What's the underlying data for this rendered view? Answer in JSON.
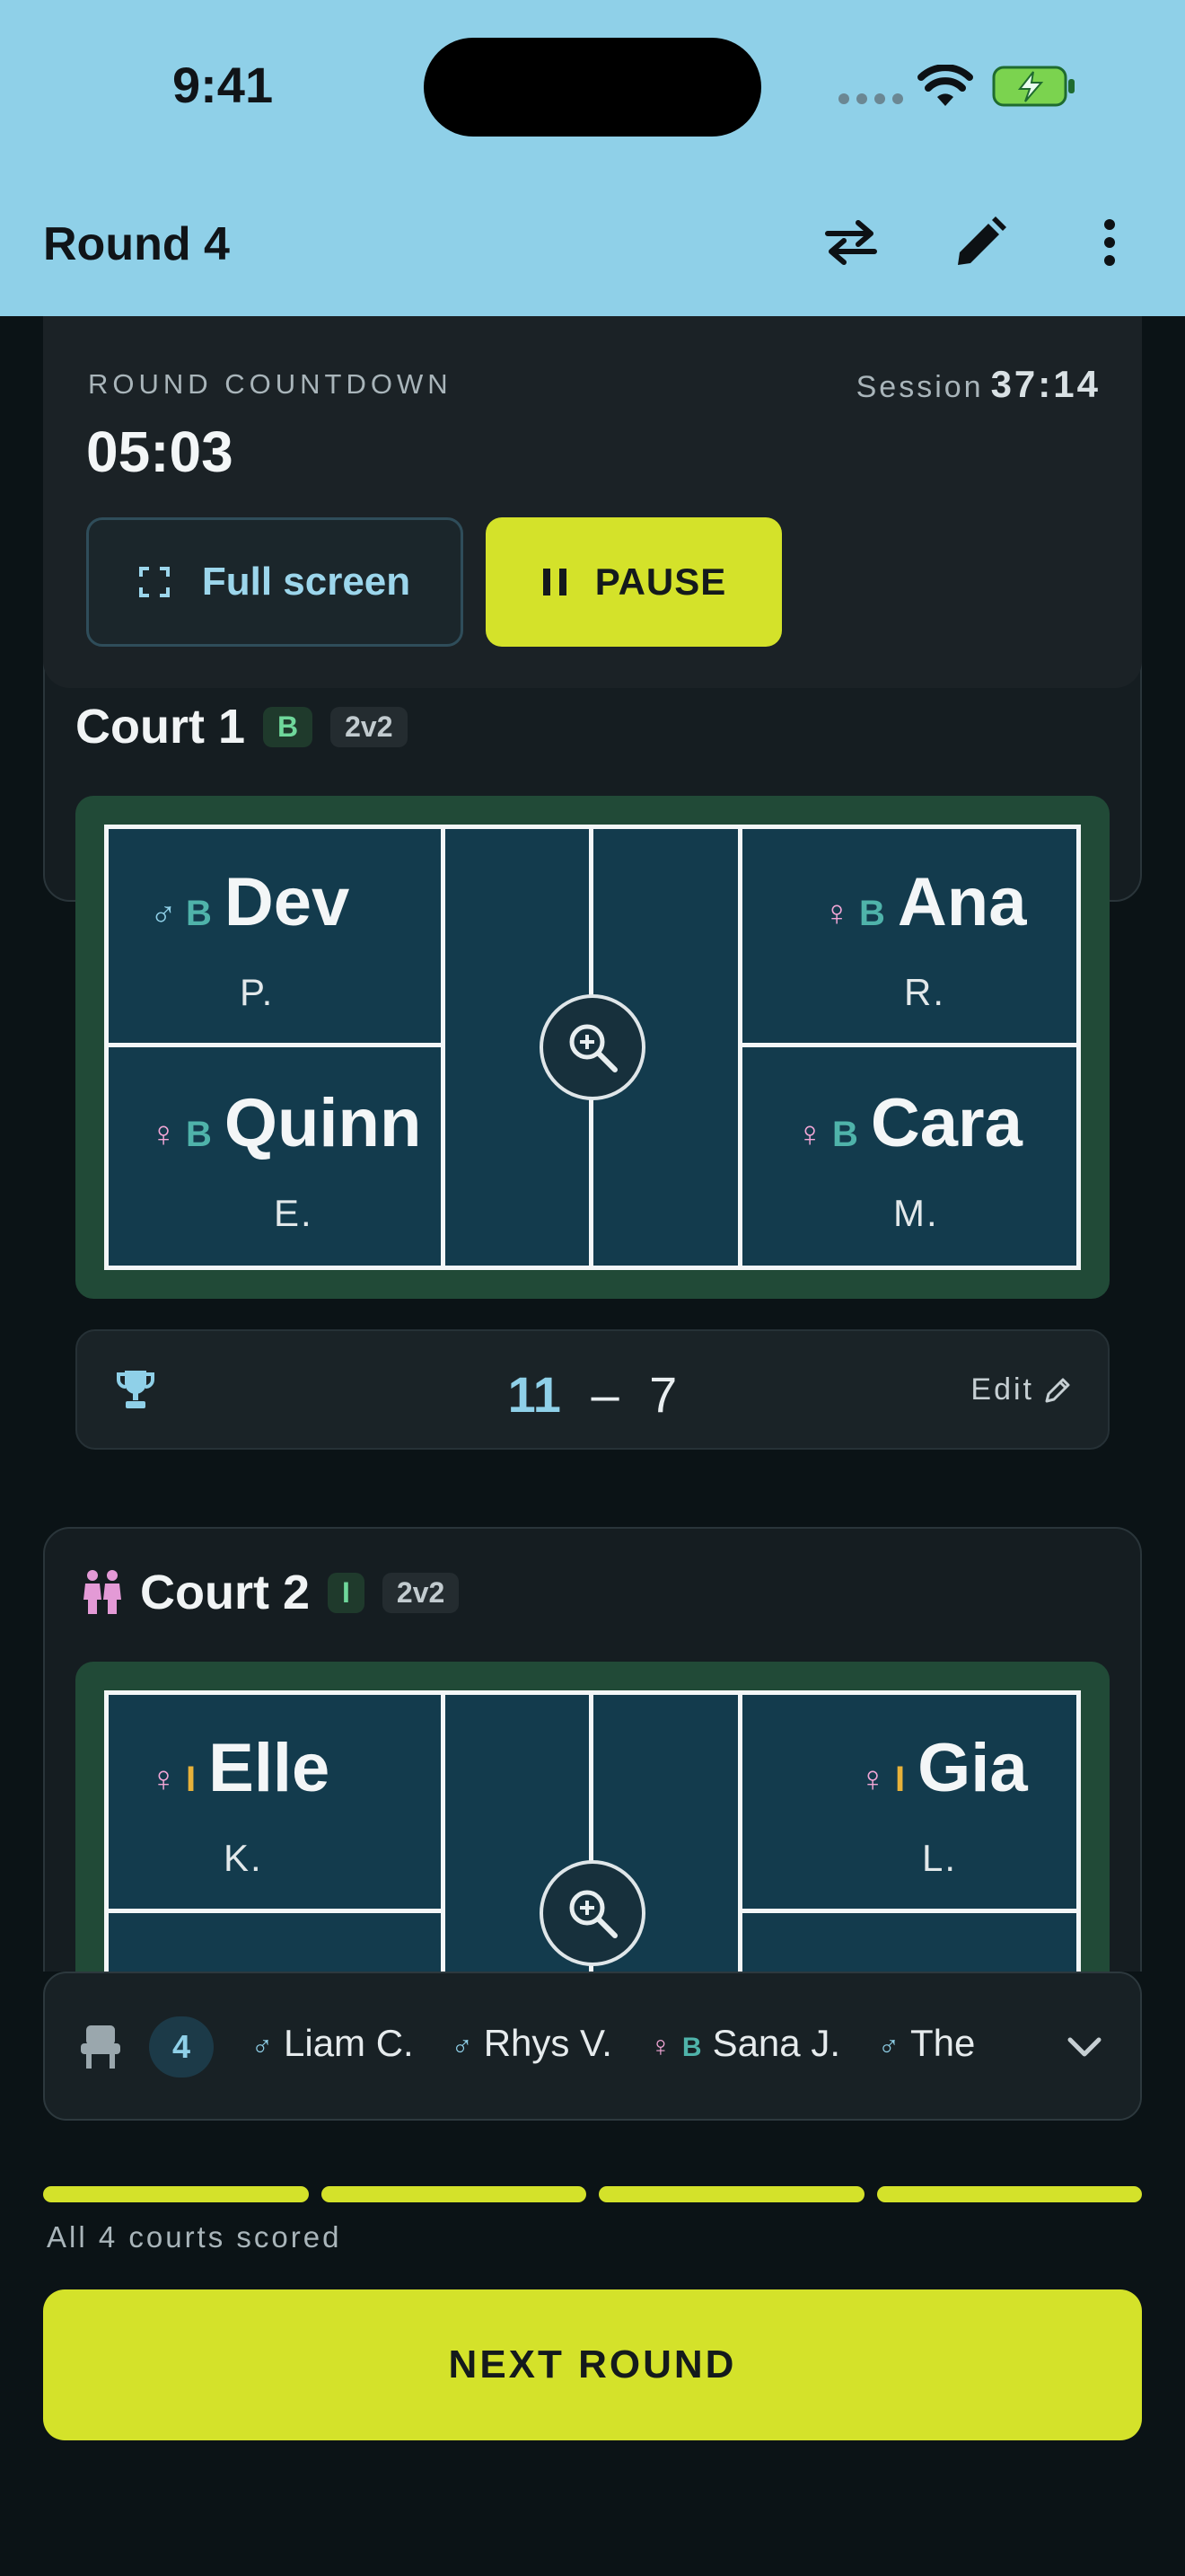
{
  "status_bar": {
    "time": "9:41"
  },
  "app_bar": {
    "title": "Round 4"
  },
  "colors": {
    "accent": "#d4e22a",
    "header": "#8fd0e8",
    "male": "#8fd0e8",
    "female": "#f2a6d6",
    "level_b": "#4fb3aa",
    "level_i": "#e8b23a",
    "court_surface": "#133b4d",
    "court_surround": "#214a37"
  },
  "countdown": {
    "label": "ROUND COUNTDOWN",
    "time": "05:03",
    "session_label": "Session",
    "session_time": "37:14",
    "full_screen_label": "Full screen",
    "pause_label": "PAUSE"
  },
  "courts": [
    {
      "name": "Court 1",
      "level": "B",
      "format": "2v2",
      "players": [
        {
          "gender": "♂",
          "level": "B",
          "first": "Dev",
          "last": "P."
        },
        {
          "gender": "♀",
          "level": "B",
          "first": "Quinn",
          "last": "E."
        },
        {
          "gender": "♀",
          "level": "B",
          "first": "Ana",
          "last": "R."
        },
        {
          "gender": "♀",
          "level": "B",
          "first": "Cara",
          "last": "M."
        }
      ],
      "score": {
        "a": "11",
        "separator": "–",
        "b": "7"
      },
      "edit_label": "Edit"
    },
    {
      "name": "Court 2",
      "icon": "women-doubles-icon",
      "level": "I",
      "format": "2v2",
      "players": [
        {
          "gender": "♀",
          "level": "I",
          "first": "Elle",
          "last": "K."
        },
        {
          "gender": "♀",
          "level": "I",
          "first": "Gia",
          "last": "L."
        }
      ]
    }
  ],
  "bench": {
    "icon": "bench-seat-icon",
    "count": "4",
    "players": [
      {
        "gender": "♂",
        "level": "",
        "name": "Liam C."
      },
      {
        "gender": "♂",
        "level": "",
        "name": "Rhys V."
      },
      {
        "gender": "♀",
        "level": "B",
        "name": "Sana J."
      },
      {
        "gender": "♂",
        "level": "",
        "name": "The"
      }
    ]
  },
  "progress": {
    "segments": 4,
    "scored": 4,
    "label": "All 4 courts scored"
  },
  "next_round": {
    "label": "NEXT ROUND"
  }
}
